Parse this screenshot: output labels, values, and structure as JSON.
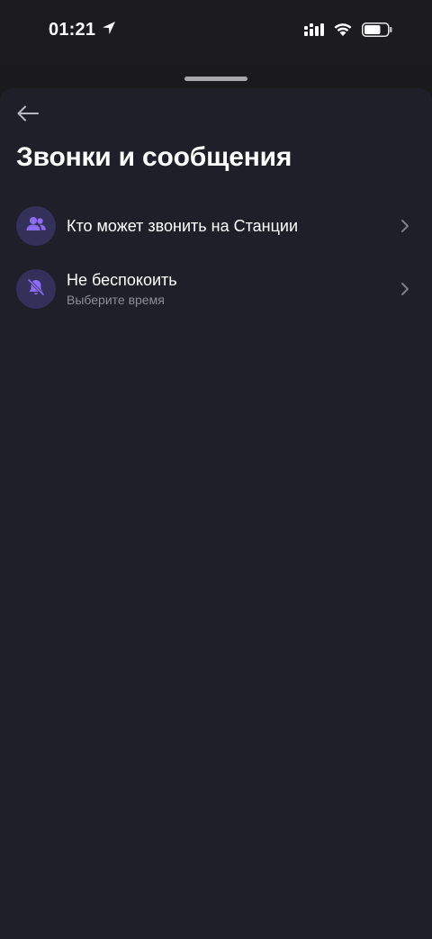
{
  "status_bar": {
    "time": "01:21",
    "location_icon": "location-arrow-icon",
    "signal_icon": "cellular-signal-icon",
    "wifi_icon": "wifi-icon",
    "battery_icon": "battery-icon",
    "battery_level": 0.7
  },
  "sheet": {
    "back_icon": "arrow-left-icon",
    "title": "Звонки и сообщения"
  },
  "items": [
    {
      "icon": "people-icon",
      "label": "Кто может звонить на Станции",
      "sublabel": ""
    },
    {
      "icon": "bell-off-icon",
      "label": "Не беспокоить",
      "sublabel": "Выберите время"
    }
  ],
  "colors": {
    "sheet_background": "#1e1f29",
    "icon_circle": "#33305a",
    "icon_accent": "#8c6df2",
    "secondary_text": "#8d8e99"
  }
}
